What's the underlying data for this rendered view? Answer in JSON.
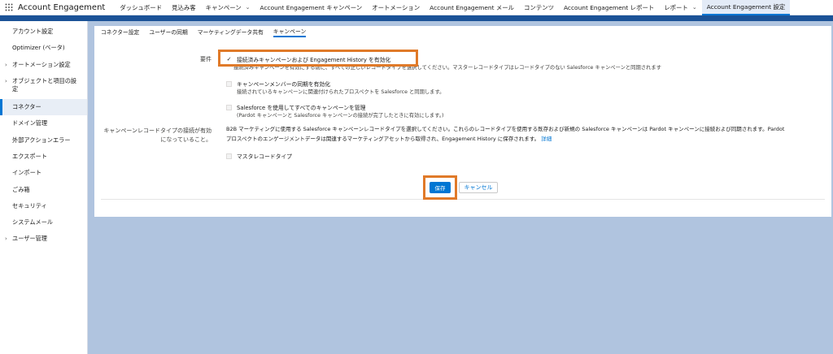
{
  "app": {
    "name": "Account Engagement"
  },
  "nav": {
    "items": [
      {
        "label": "ダッシュボード",
        "has_menu": false
      },
      {
        "label": "見込み客",
        "has_menu": false
      },
      {
        "label": "キャンペーン",
        "has_menu": true
      },
      {
        "label": "Account Engagement キャンペーン",
        "has_menu": false
      },
      {
        "label": "オートメーション",
        "has_menu": false
      },
      {
        "label": "Account Engagement メール",
        "has_menu": false
      },
      {
        "label": "コンテンツ",
        "has_menu": false
      },
      {
        "label": "Account Engagement レポート",
        "has_menu": false
      },
      {
        "label": "レポート",
        "has_menu": true
      },
      {
        "label": "Account Engagement 設定",
        "has_menu": false,
        "active": true
      }
    ]
  },
  "sidebar": {
    "items": [
      {
        "label": "アカウント設定"
      },
      {
        "label": "Optimizer (ベータ)"
      },
      {
        "label": "オートメーション設定",
        "expandable": true
      },
      {
        "label": "オブジェクトと項目の設定",
        "expandable": true
      },
      {
        "label": "コネクター",
        "active": true
      },
      {
        "label": "ドメイン管理"
      },
      {
        "label": "外部アクションエラー"
      },
      {
        "label": "エクスポート"
      },
      {
        "label": "インポート"
      },
      {
        "label": "ごみ箱"
      },
      {
        "label": "セキュリティ"
      },
      {
        "label": "システムメール"
      },
      {
        "label": "ユーザー管理",
        "expandable": true
      }
    ]
  },
  "tabs": [
    {
      "label": "コネクター設定"
    },
    {
      "label": "ユーザーの同期"
    },
    {
      "label": "マーケティングデータ共有"
    },
    {
      "label": "キャンペーン",
      "active": true
    }
  ],
  "form": {
    "conditions_label": "要件",
    "option1": {
      "label": "接続済みキャンペーンおよび Engagement History を有効化",
      "sub": "接続済みキャンペーンを有効にする前に、すべての正しいレコードタイプを選択してください。マスターレコードタイプはレコードタイプのない Salesforce キャンペーンと同期されます"
    },
    "option2": {
      "label": "キャンペーンメンバーの同期を有効化",
      "sub": "接続されているキャンペーンに関連付けられたプロスペクトを Salesforce と同期します。"
    },
    "option3": {
      "label": "Salesforce を使用してすべてのキャンペーンを管理",
      "sub": "(Pardot キャンペーンと Salesforce キャンペーンの接続が完了したときに有効にします。)"
    },
    "record_type_label_line1": "キャンペーンレコードタイプの接続が有効",
    "record_type_label_line2": "になっていること。",
    "record_type_desc_line1": "B2B マーケティングに使用する Salesforce キャンペーンレコードタイプを選択してください。これらのレコードタイプを使用する既存および新規の Salesforce キャンペーンは Pardot キャンペーンに接続および同期されます。Pardot",
    "record_type_desc_line2": "プロスペクトのエンゲージメントデータは関連するマーケティングアセットから取得され、Engagement History に保存されます。",
    "record_type_link": "詳細",
    "master_record_label": "マスタレコードタイプ"
  },
  "buttons": {
    "save": "保存",
    "cancel": "キャンセル"
  },
  "colors": {
    "highlight": "#e07a29",
    "brand": "#0176d3",
    "brandbar": "#1b5297",
    "background": "#b0c4df"
  }
}
